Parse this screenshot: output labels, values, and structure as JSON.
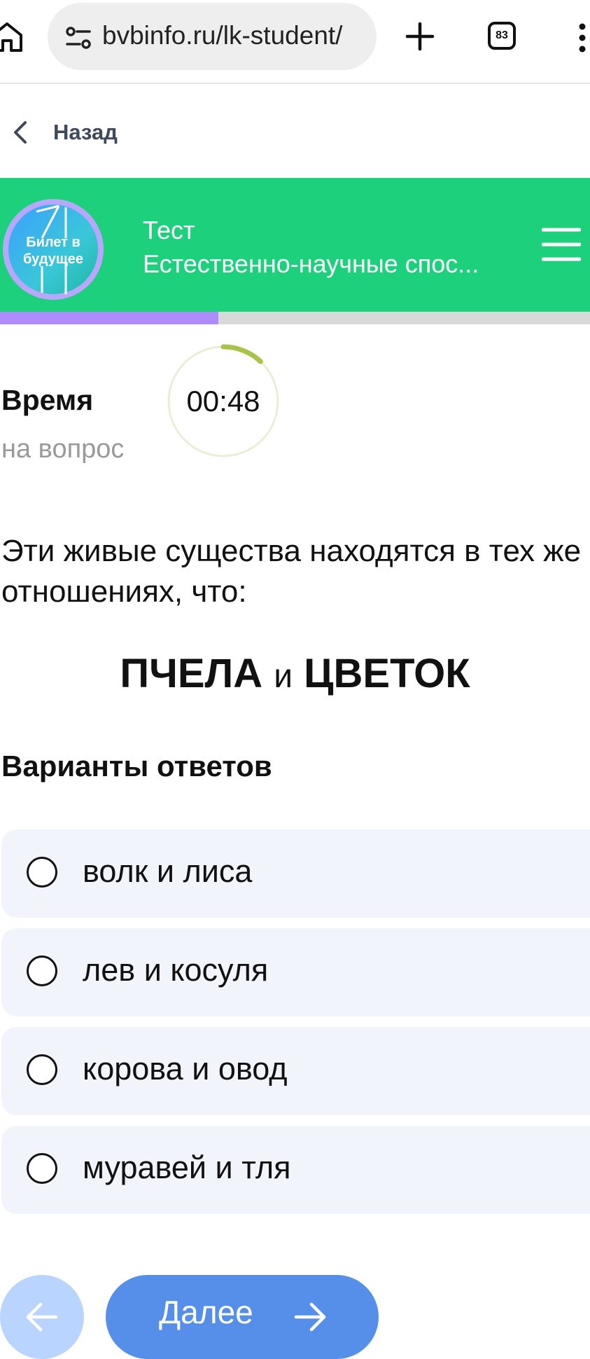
{
  "browser": {
    "url": "bvbinfo.ru/lk-student/",
    "tabs_count": "83"
  },
  "nav": {
    "back_label": "Назад"
  },
  "header": {
    "logo_text_line1": "Билет в",
    "logo_text_line2": "будущее",
    "title": "Тест",
    "subtitle": "Естественно-научные спос...",
    "background_color": "#1cd07c"
  },
  "progress": {
    "fraction": 0.37,
    "fill_color": "#ae8cff",
    "track_color": "#d9d9d9"
  },
  "timer": {
    "title": "Время",
    "subtitle": "на вопрос",
    "value": "00:48",
    "remaining_fraction": 0.12
  },
  "question": {
    "text": "Эти живые существа находятся в тех же отношениях, что:",
    "word1": "ПЧЕЛА",
    "conjunction": "и",
    "word2": "ЦВЕТОК"
  },
  "answers": {
    "heading": "Варианты ответов",
    "options": [
      {
        "label": "волк и лиса"
      },
      {
        "label": "лев и косуля"
      },
      {
        "label": "корова и овод"
      },
      {
        "label": "муравей и тля"
      }
    ]
  },
  "footer": {
    "next_label": "Далее"
  }
}
